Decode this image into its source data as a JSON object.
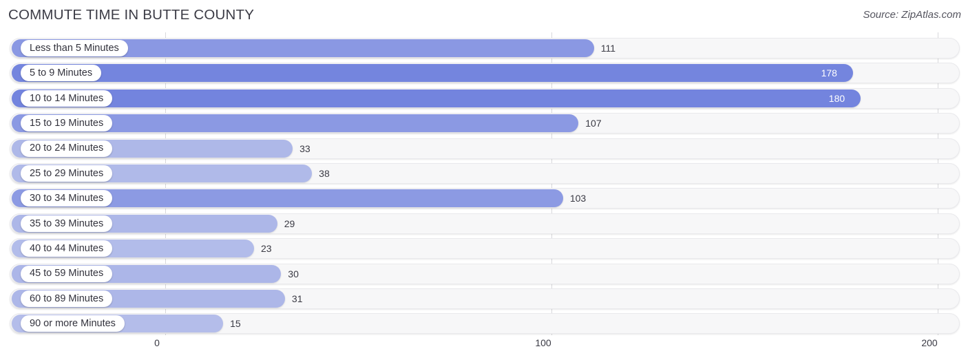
{
  "header": {
    "title": "COMMUTE TIME IN BUTTE COUNTY",
    "source": "Source: ZipAtlas.com"
  },
  "colors": {
    "bar": "#8190e2",
    "bar_light": "#b6c0ea",
    "track": "#f7f7f8",
    "gridline": "#d8d8dc",
    "text": "#3a3a44",
    "value_inside": "#ffffff"
  },
  "axis": {
    "ticks": [
      "0",
      "100",
      "200"
    ],
    "min": 0,
    "max": 200
  },
  "chart_data": {
    "type": "bar",
    "orientation": "horizontal",
    "title": "COMMUTE TIME IN BUTTE COUNTY",
    "subtitle": "",
    "xlabel": "",
    "ylabel": "",
    "xlim": [
      0,
      200
    ],
    "xticks": [
      0,
      100,
      200
    ],
    "grid": true,
    "legend": null,
    "source": "Source: ZipAtlas.com",
    "categories": [
      "Less than 5 Minutes",
      "5 to 9 Minutes",
      "10 to 14 Minutes",
      "15 to 19 Minutes",
      "20 to 24 Minutes",
      "25 to 29 Minutes",
      "30 to 34 Minutes",
      "35 to 39 Minutes",
      "40 to 44 Minutes",
      "45 to 59 Minutes",
      "60 to 89 Minutes",
      "90 or more Minutes"
    ],
    "values": [
      111,
      178,
      180,
      107,
      33,
      38,
      103,
      29,
      23,
      30,
      31,
      15
    ]
  },
  "rows": [
    {
      "label": "Less than 5 Minutes",
      "value": 111,
      "value_text": "111",
      "inside": false,
      "shade": "#8a98e3"
    },
    {
      "label": "5 to 9 Minutes",
      "value": 178,
      "value_text": "178",
      "inside": true,
      "shade": "#7485de"
    },
    {
      "label": "10 to 14 Minutes",
      "value": 180,
      "value_text": "180",
      "inside": true,
      "shade": "#7384de"
    },
    {
      "label": "15 to 19 Minutes",
      "value": 107,
      "value_text": "107",
      "inside": false,
      "shade": "#8b99e3"
    },
    {
      "label": "20 to 24 Minutes",
      "value": 33,
      "value_text": "33",
      "inside": false,
      "shade": "#aeb8e8"
    },
    {
      "label": "25 to 29 Minutes",
      "value": 38,
      "value_text": "38",
      "inside": false,
      "shade": "#b0bae9"
    },
    {
      "label": "30 to 34 Minutes",
      "value": 103,
      "value_text": "103",
      "inside": false,
      "shade": "#8c9ae3"
    },
    {
      "label": "35 to 39 Minutes",
      "value": 29,
      "value_text": "29",
      "inside": false,
      "shade": "#adb7e8"
    },
    {
      "label": "40 to 44 Minutes",
      "value": 23,
      "value_text": "23",
      "inside": false,
      "shade": "#b2bcea"
    },
    {
      "label": "45 to 59 Minutes",
      "value": 30,
      "value_text": "30",
      "inside": false,
      "shade": "#acb6e8"
    },
    {
      "label": "60 to 89 Minutes",
      "value": 31,
      "value_text": "31",
      "inside": false,
      "shade": "#adb7e8"
    },
    {
      "label": "90 or more Minutes",
      "value": 15,
      "value_text": "15",
      "inside": false,
      "shade": "#b4bdea"
    }
  ]
}
